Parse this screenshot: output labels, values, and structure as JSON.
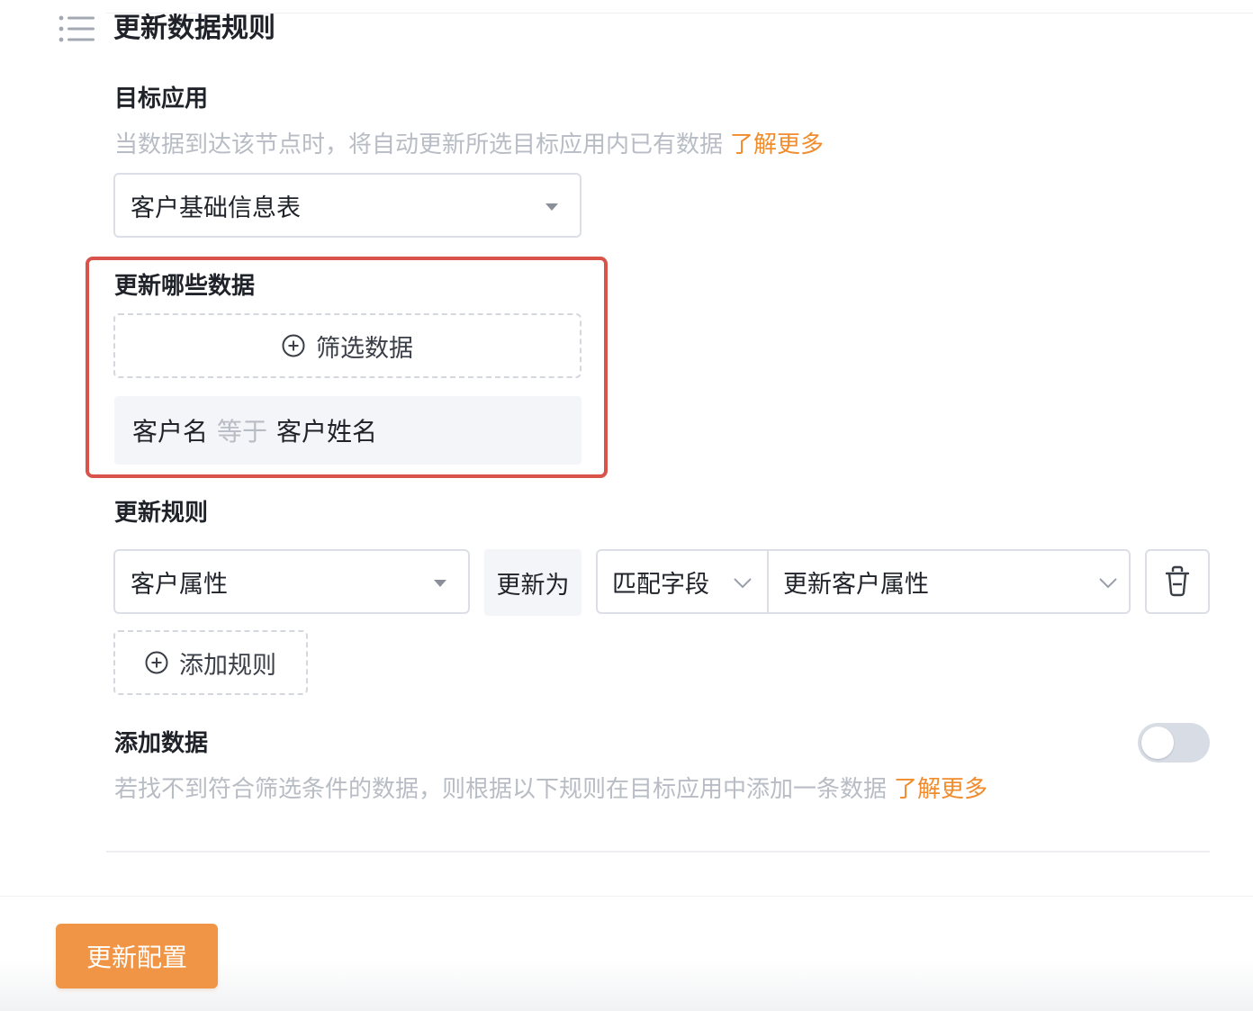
{
  "section": {
    "title": "更新数据规则"
  },
  "target_app": {
    "label": "目标应用",
    "help": "当数据到达该节点时，将自动更新所选目标应用内已有数据",
    "help_link": "了解更多",
    "selected": "客户基础信息表"
  },
  "which_data": {
    "label": "更新哪些数据",
    "filter_button": "筛选数据",
    "condition": {
      "field": "客户名",
      "operator": "等于",
      "value": "客户姓名"
    }
  },
  "update_rules": {
    "label": "更新规则",
    "rule": {
      "field": "客户属性",
      "action": "更新为",
      "mode": "匹配字段",
      "source": "更新客户属性"
    },
    "add_button": "添加规则"
  },
  "add_data": {
    "label": "添加数据",
    "help": "若找不到符合筛选条件的数据，则根据以下规则在目标应用中添加一条数据",
    "help_link": "了解更多",
    "enabled": false
  },
  "footer": {
    "primary_button": "更新配置"
  },
  "colors": {
    "accent": "#ef9545",
    "link": "#f08c2d",
    "highlight_border": "#d9534a"
  }
}
